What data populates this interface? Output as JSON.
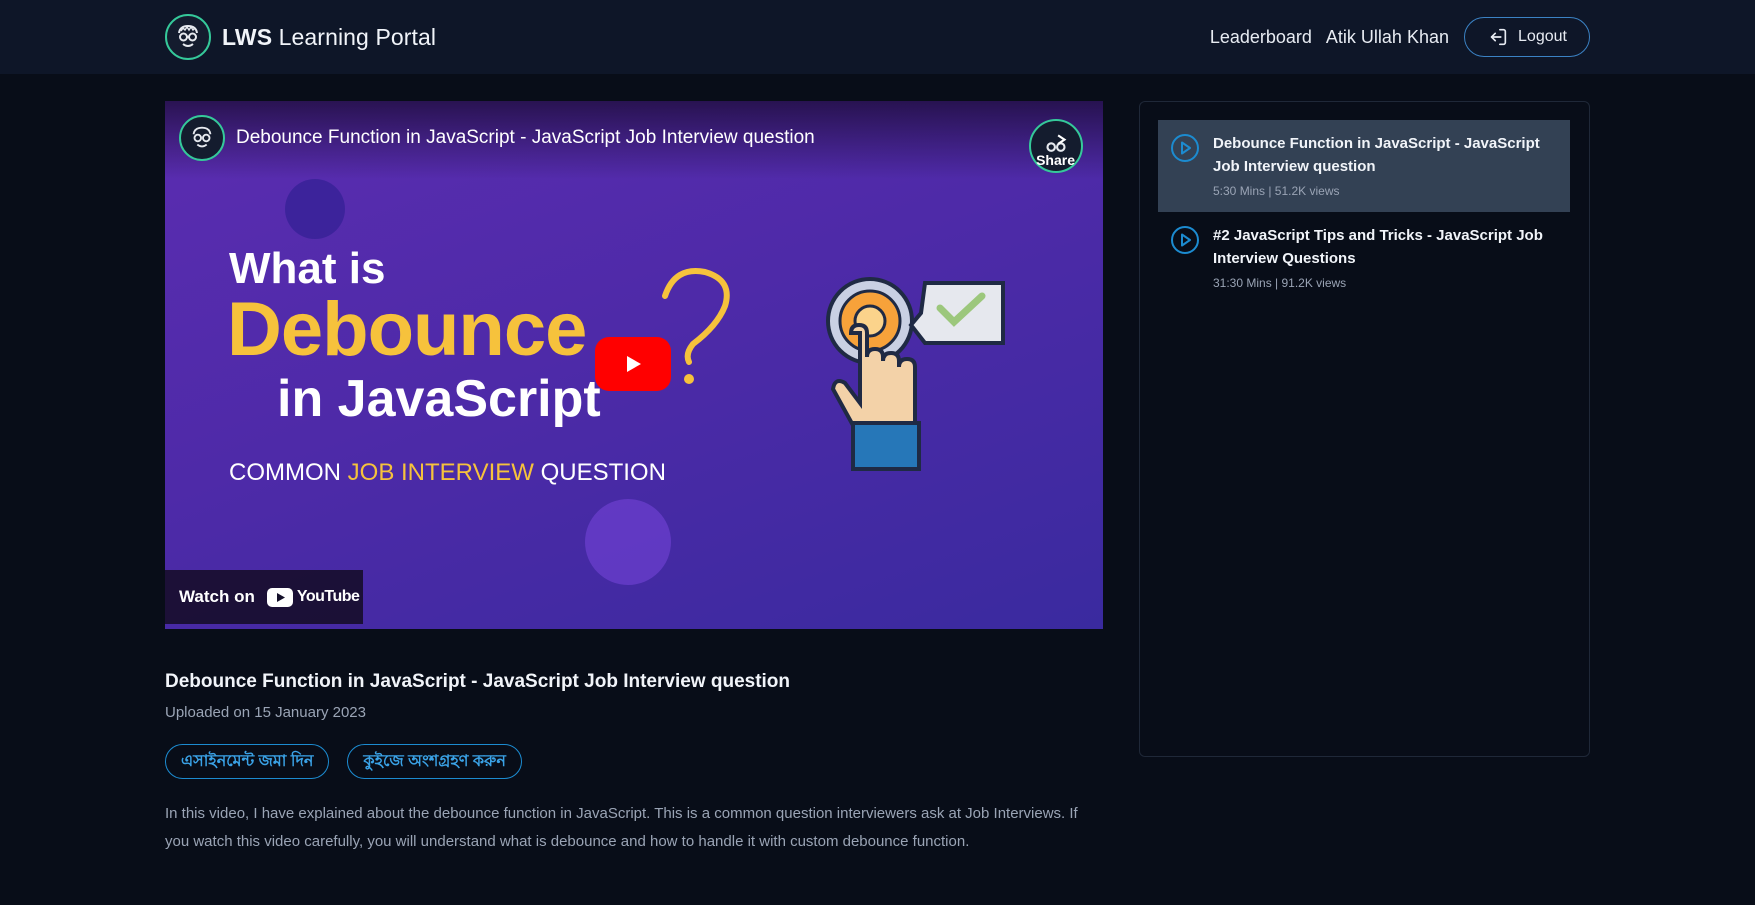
{
  "header": {
    "brand_bold": "LWS",
    "brand_rest": " Learning Portal",
    "leaderboard": "Leaderboard",
    "user_name": "Atik Ullah Khan",
    "logout": "Logout"
  },
  "video": {
    "title": "Debounce Function in JavaScript - JavaScript Job Interview question",
    "share": "Share",
    "thumbnail": {
      "line1": "What is",
      "line2": "Debounce",
      "line3": "in JavaScript",
      "line4_pre": "COMMON ",
      "line4_hl": "JOB INTERVIEW",
      "line4_post": " QUESTION"
    },
    "watch_on": "Watch on",
    "youtube": "YouTube"
  },
  "info": {
    "title": "Debounce Function in JavaScript - JavaScript Job Interview question",
    "uploaded": "Uploaded on 15 January 2023",
    "assignment_btn": "এসাইনমেন্ট জমা দিন",
    "quiz_btn": "কুইজে অংশগ্রহণ করুন",
    "description": "In this video, I have explained about the debounce function in JavaScript. This is a common question interviewers ask at Job Interviews. If you watch this video carefully, you will understand what is debounce and how to handle it with custom debounce function."
  },
  "playlist": {
    "items": [
      {
        "title": "Debounce Function in JavaScript - JavaScript Job Interview question",
        "meta": "5:30 Mins | 51.2K views",
        "active": true
      },
      {
        "title": "#2 JavaScript Tips and Tricks - JavaScript Job Interview Questions",
        "meta": "31:30 Mins | 91.2K views",
        "active": false
      }
    ]
  },
  "colors": {
    "accent": "#35c99a",
    "link_blue": "#3aa2e6",
    "youtube_red": "#ff0000",
    "thumb_yellow": "#f6c23c"
  }
}
